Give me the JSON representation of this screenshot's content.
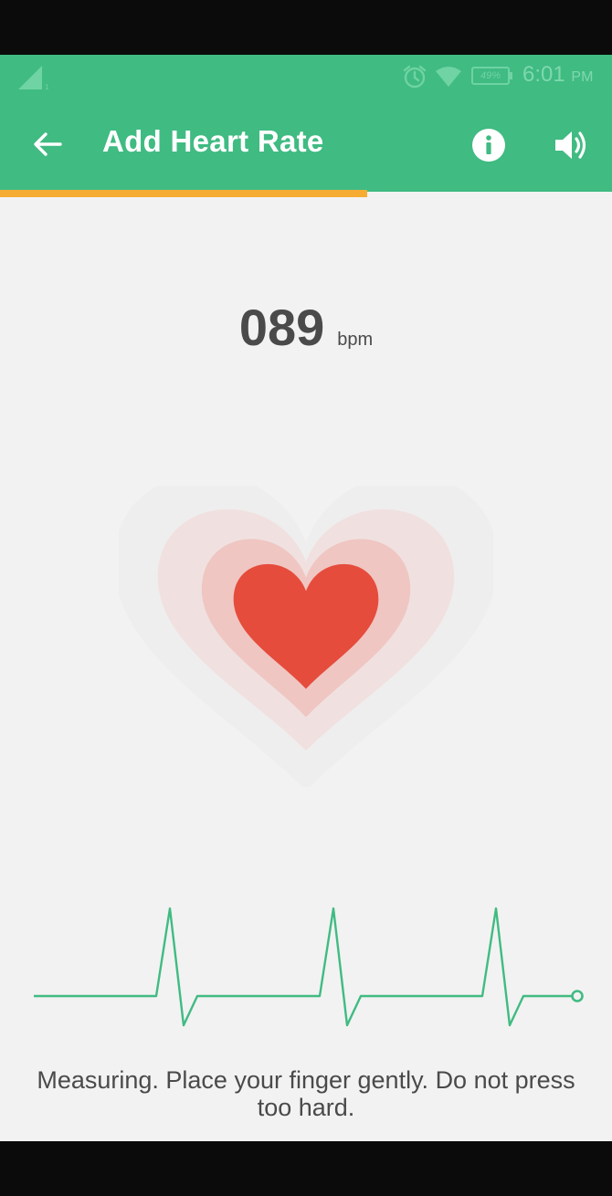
{
  "status_bar": {
    "battery_percent": "49%",
    "time": "6:01",
    "time_suffix": "PM",
    "icons": [
      "signal-icon",
      "alarm-icon",
      "wifi-icon",
      "battery-icon"
    ]
  },
  "toolbar": {
    "title": "Add Heart Rate",
    "back_icon": "arrow-left-icon",
    "info_icon": "info-icon",
    "sound_icon": "volume-icon"
  },
  "progress": {
    "value": 0.6,
    "color": "#f6ac33"
  },
  "measurement": {
    "value": "089",
    "unit": "bpm"
  },
  "instruction": "Measuring. Place your finger gently. Do not press too hard.",
  "colors": {
    "accent": "#40bb82",
    "heart": "#e54c3c",
    "progress": "#f6ac33",
    "background": "#f2f2f2"
  }
}
